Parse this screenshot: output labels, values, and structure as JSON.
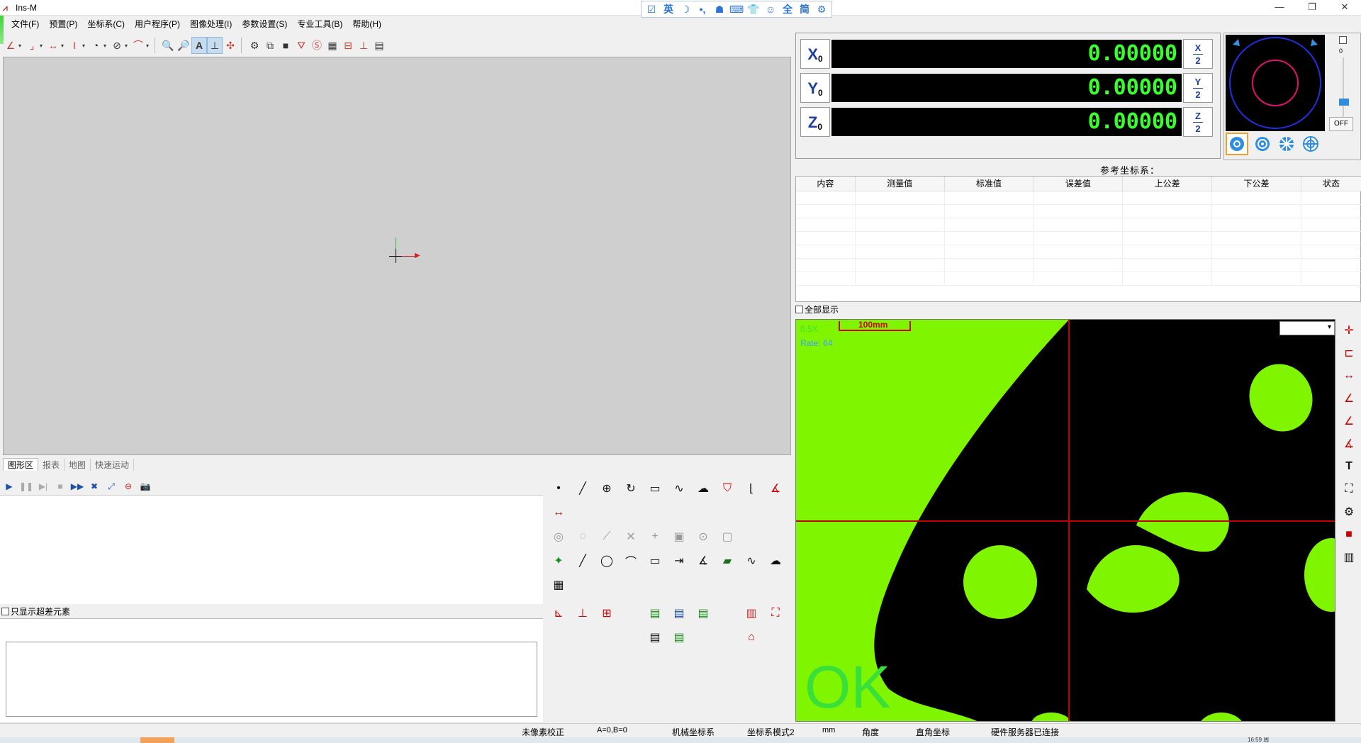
{
  "window": {
    "title": "Ins-M",
    "controls": [
      "—",
      "❐",
      "✕"
    ]
  },
  "ime": {
    "items": [
      "☑",
      "英",
      "☽",
      "•,",
      "☗",
      "⌨",
      "👕",
      "☺",
      "全",
      "简",
      "⚙"
    ]
  },
  "menu": [
    "文件(F)",
    "预置(P)",
    "坐标系(C)",
    "用户程序(P)",
    "图像处理(I)",
    "参数设置(S)",
    "专业工具(B)",
    "帮助(H)"
  ],
  "tabs": [
    "图形区",
    "报表",
    "地图",
    "快速运动"
  ],
  "dro": {
    "x_label": "X",
    "y_label": "Y",
    "z_label": "Z",
    "sub": "0",
    "x_value": "0.00000",
    "y_value": "0.00000",
    "z_value": "0.00000",
    "half_top_x": "X",
    "half_top_y": "Y",
    "half_top_z": "Z",
    "half_bottom": "2"
  },
  "light": {
    "top_value": "0",
    "off_label": "OFF"
  },
  "reference": {
    "label": "参考坐标系："
  },
  "results": {
    "headers": [
      "内容",
      "测量值",
      "标准值",
      "误差值",
      "上公差",
      "下公差",
      "状态"
    ],
    "rows": 7
  },
  "show_all": "全部显示",
  "only_exceed": "只显示超差元素",
  "camera": {
    "magnification": "0.5X",
    "rate": "Rate: 64",
    "scale_label": "100mm",
    "result": "OK"
  },
  "status": {
    "pixel_calib": "未像素校正",
    "ab": "A=0,B=0",
    "machine_coord": "机械坐标系",
    "coord_mode": "坐标系模式2",
    "unit": "mm",
    "angle": "角度",
    "rect_coord": "直角坐标",
    "hw_server": "硬件服务器已连接"
  },
  "taskbar": {
    "time": "16:59 周"
  },
  "colors": {
    "display_green": "#39ff2c",
    "camera_green": "#7ff500",
    "crosshair": "#c00000",
    "accent_blue": "#1f3f9f"
  }
}
